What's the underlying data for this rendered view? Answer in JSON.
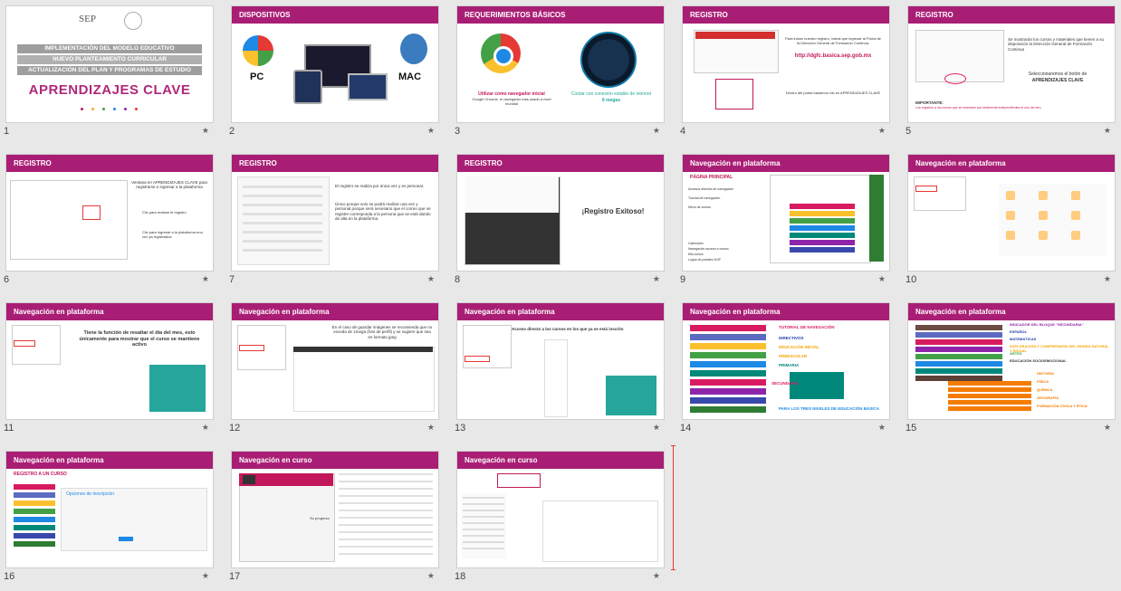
{
  "slides": [
    {
      "num": "1",
      "title": "",
      "lines": [
        "IMPLEMENTACIÓN DEL MODELO EDUCATIVO",
        "NUEVO PLANTEAMIENTO CURRICULAR",
        "ACTUALIZACIÓN DEL PLAN Y PROGRAMAS DE ESTUDIO"
      ],
      "sep": "SEP",
      "big": "APRENDIZAJES CLAVE"
    },
    {
      "num": "2",
      "title": "DISPOSITIVOS",
      "pc": "PC",
      "mac": "MAC"
    },
    {
      "num": "3",
      "title": "REQUERIMIENTOS BÁSICOS",
      "browser": "Utilizar como navegador inicial",
      "browser2": "Google Chrome, el navegador más usado a nivel mundial",
      "conn": "Contar con conexión estable de internet",
      "speed": "6 megas"
    },
    {
      "num": "4",
      "title": "REGISTRO",
      "t1": "Para iniciar nuestro registro, habrá que ingresar al Portal de la Dirección General de Formación Continua:",
      "url": "http://dgfc.basica.sep.gob.mx",
      "t2": "Dentro del portal basamos clic en APRENDIZAJES CLAVE"
    },
    {
      "num": "5",
      "title": "REGISTRO",
      "t1": "Se mostrarán los cursos y materiales que tienen a su disposición la Dirección General de Formación Continua",
      "t2": "Seleccionaremos el botón de",
      "t3": "APRENDIZAJES CLAVE",
      "t4": "IMPORTANTE:",
      "t5": "Los registros a los cursos que se muestran son totalmente independientes el uno del otro."
    },
    {
      "num": "6",
      "title": "REGISTRO",
      "t1": "Ventana en APRENDIZAJES CLAVE para registrarse e ingresar a la plataforma",
      "t2": "Clic para realizar el registro",
      "t3": "Clic para ingresar a la plataforma una vez ya registrados"
    },
    {
      "num": "7",
      "title": "REGISTRO",
      "t1": "El registro se realiza por única vez y es personal.",
      "t2": "Único porque solo se podrá realizar una vez y personal porque será necesario que el correo que se registre corresponda a la persona que se está dando de alta en la plataforma."
    },
    {
      "num": "8",
      "title": "REGISTRO",
      "t1": "¡Registro Exitoso!"
    },
    {
      "num": "9",
      "title": "Navegación en plataforma",
      "t0": "PÁGINA PRINCIPAL",
      "items": [
        "Accesos directos de navegación",
        "Tutorial de navegación",
        "Menú de cursos"
      ],
      "items2": [
        "Calendario",
        "Navegación acceso a cursos",
        "Mis cursos",
        "Logos de portales DGF"
      ]
    },
    {
      "num": "10",
      "title": "Navegación en plataforma"
    },
    {
      "num": "11",
      "title": "Navegación en plataforma",
      "t1": "Tiene la función de resaltar el día del mes, esto únicamente para mostrar que el curso se mantiene activo"
    },
    {
      "num": "12",
      "title": "Navegación en plataforma",
      "t1": "En el caso de guardar imágenes se recomienda que no exceda de 1mega (foto de perfil) y se sugiere que sea en formato jpeg"
    },
    {
      "num": "13",
      "title": "Navegación en plataforma",
      "t1": "Acceso directo a los cursos en los que ya se está inscrito"
    },
    {
      "num": "14",
      "title": "Navegación en plataforma",
      "labels": [
        "TUTORIAL DE NAVEGACIÓN",
        "DIRECTIVOS",
        "EDUCACIÓN INICIAL",
        "PREESCOLAR",
        "PRIMARIA",
        "SECUNDARIA",
        "PARA LOS TRES NIVELES DE EDUCACIÓN BÁSICA"
      ]
    },
    {
      "num": "15",
      "title": "Navegación en plataforma",
      "labels": [
        "INDICADOR DEL BLOQUE \"SECUNDARIA\"",
        "ESPAÑOL",
        "MATEMÁTICAS",
        "EXPLORACIÓN Y COMPRENSIÓN DEL MUNDO NATURAL Y SOCIAL",
        "ARTES",
        "EDUCACIÓN SOCIOEMOCIONAL",
        "HISTORIA",
        "FÍSICA",
        "QUÍMICA",
        "GEOGRAFÍA",
        "FORMACIÓN CÍVICA Y ÉTICA"
      ]
    },
    {
      "num": "16",
      "title": "Navegación en plataforma",
      "t0": "REGISTRO A UN CURSO",
      "t1": "Opciones de inscripción"
    },
    {
      "num": "17",
      "title": "Navegación en curso",
      "t1": "Su progreso"
    },
    {
      "num": "18",
      "title": "Navegación en curso"
    }
  ],
  "colors": {
    "accent": "#a91e75",
    "background": "#e8e8e8"
  },
  "star_icon": "★"
}
